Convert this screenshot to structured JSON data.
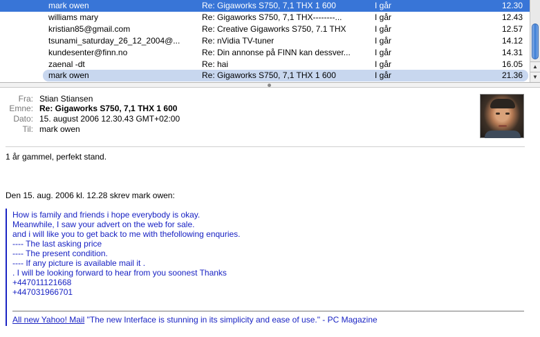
{
  "message_list": {
    "rows": [
      {
        "from": "mark owen",
        "subject": "Re: Gigaworks S750, 7,1 THX 1 600",
        "date": "I går",
        "time": "12.30"
      },
      {
        "from": "williams mary",
        "subject": "Re: Gigaworks S750, 7,1 THX--------...",
        "date": "I går",
        "time": "12.43"
      },
      {
        "from": "kristian85@gmail.com",
        "subject": "Re: Creative Gigaworks S750, 7.1 THX",
        "date": "I går",
        "time": "12.57"
      },
      {
        "from": "tsunami_saturday_26_12_2004@...",
        "subject": "Re: nVidia TV-tuner",
        "date": "I går",
        "time": "14.12"
      },
      {
        "from": "kundesenter@finn.no",
        "subject": "Re: Din annonse på FINN kan dessver...",
        "date": "I går",
        "time": "14.31"
      },
      {
        "from": "zaenal -dt",
        "subject": "Re: hai",
        "date": "I går",
        "time": "16.05"
      },
      {
        "from": "mark owen",
        "subject": "Re: Gigaworks S750, 7,1 THX 1 600",
        "date": "I går",
        "time": "21.36"
      }
    ]
  },
  "scrollbar": {
    "up_icon": "▲",
    "down_icon": "▼"
  },
  "header": {
    "from_label": "Fra:",
    "from_value": "Stian Stiansen",
    "subject_label": "Emne:",
    "subject_value": "Re: Gigaworks S750, 7,1 THX 1 600",
    "date_label": "Dato:",
    "date_value": "15. august 2006 12.30.43 GMT+02:00",
    "to_label": "Til:",
    "to_value": "mark owen"
  },
  "body": {
    "line1": "1 år gammel, perfekt stand.",
    "attribution": "Den 15. aug. 2006 kl. 12.28 skrev mark owen:",
    "quote_lines": [
      "How is family and friends i hope everybody is okay.",
      "Meanwhile, I saw your advert on the web for sale.",
      "and i will like you to get back to me with thefollowing enquries.",
      "---- The last asking price",
      "---- The present condition.",
      "---- If any picture is available mail it .",
      ". I will be looking forward to hear from you soonest Thanks",
      "+447011121668",
      "+447031966701"
    ],
    "footer_link": "All new Yahoo! Mail",
    "footer_text": " \"The new Interface is stunning in its simplicity and ease of use.\" - PC Magazine"
  }
}
